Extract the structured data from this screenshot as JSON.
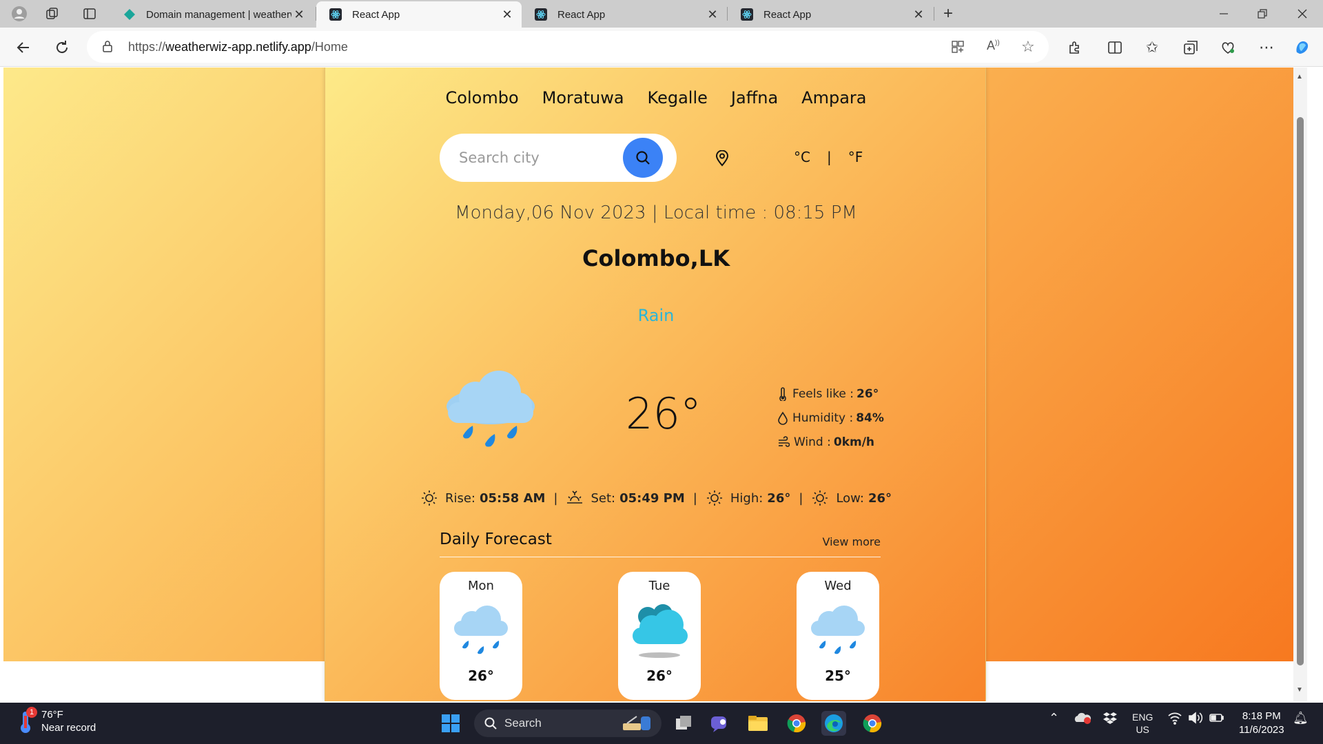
{
  "browser": {
    "tabs": [
      {
        "title": "Domain management | weatherwiz-app",
        "active": false
      },
      {
        "title": "React App",
        "active": true
      },
      {
        "title": "React App",
        "active": false
      },
      {
        "title": "React App",
        "active": false
      }
    ],
    "url_scheme": "https://",
    "url_host": "weatherwiz-app.netlify.app",
    "url_path": "/Home"
  },
  "app": {
    "cities": [
      "Colombo",
      "Moratuwa",
      "Kegalle",
      "Jaffna",
      "Ampara"
    ],
    "search": {
      "placeholder": "Search city"
    },
    "units": {
      "celsius": "°C",
      "separator": "|",
      "fahrenheit": "°F"
    },
    "datetime": "Monday,06 Nov 2023 | Local time : 08:15 PM",
    "location": "Colombo,LK",
    "condition": "Rain",
    "temperature": "26°",
    "details": {
      "feels_like_label": "Feels like :",
      "feels_like": "26°",
      "humidity_label": "Humidity :",
      "humidity": "84%",
      "wind_label": "Wind :",
      "wind": "0km/h"
    },
    "sun": {
      "rise_label": "Rise:",
      "rise": "05:58 AM",
      "set_label": "Set:",
      "set": "05:49 PM",
      "high_label": "High:",
      "high": "26°",
      "low_label": "Low:",
      "low": "26°",
      "separator": "|"
    },
    "forecast": {
      "title": "Daily Forecast",
      "view_more": "View more",
      "days": [
        {
          "day": "Mon",
          "temp": "26°",
          "icon": "rain-cloud-icon"
        },
        {
          "day": "Tue",
          "temp": "26°",
          "icon": "cloudy-icon"
        },
        {
          "day": "Wed",
          "temp": "25°",
          "icon": "rain-cloud-icon"
        }
      ]
    },
    "colors": {
      "accent": "#3b82f6",
      "condition": "#2bb5d8",
      "gradient_start": "#fde98a",
      "gradient_end": "#f7781f"
    }
  },
  "taskbar": {
    "weather_temp": "76°F",
    "weather_desc": "Near record",
    "weather_badge": "1",
    "search_label": "Search",
    "lang_top": "ENG",
    "lang_bottom": "US",
    "time": "8:18 PM",
    "date": "11/6/2023"
  }
}
